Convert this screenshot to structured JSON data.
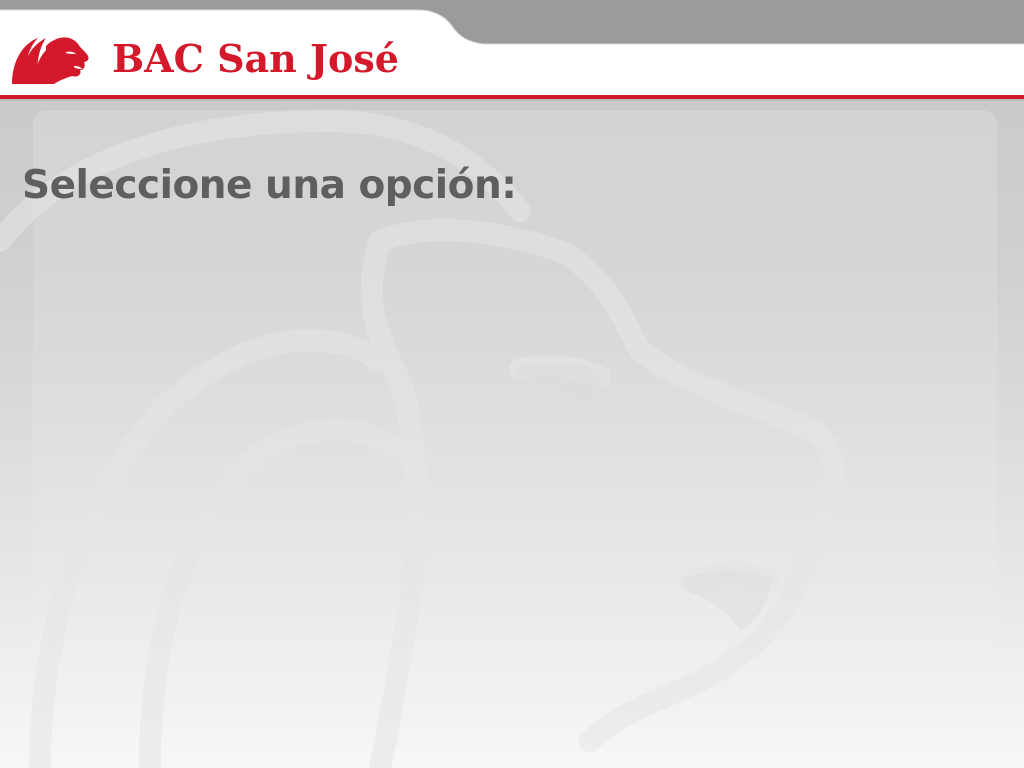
{
  "header": {
    "brand_name": "BAC San José",
    "logo_icon": "lion-head-icon",
    "colors": {
      "brand_red": "#d3192a",
      "top_bar_gray": "#9b9b9b"
    }
  },
  "main": {
    "prompt": "Seleccione una opción:",
    "background_watermark": "lion-watermark-icon",
    "colors": {
      "prompt_text": "#5f5f5f"
    }
  }
}
